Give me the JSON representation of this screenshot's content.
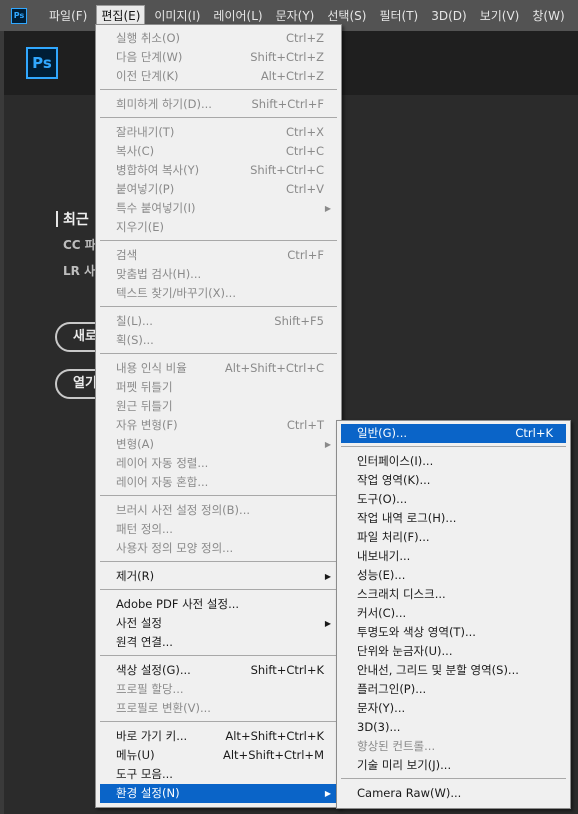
{
  "menubar": {
    "app_icon": "Ps",
    "items": [
      "파일(F)",
      "편집(E)",
      "이미지(I)",
      "레이어(L)",
      "문자(Y)",
      "선택(S)",
      "필터(T)",
      "3D(D)",
      "보기(V)",
      "창(W)"
    ],
    "active_index": 1
  },
  "home": {
    "logo": "Ps",
    "recent_title": "최근",
    "sub1": "CC 파",
    "sub2": "LR 사",
    "btn_new": "새로",
    "btn_open": "열기"
  },
  "edit_menu": {
    "undo": {
      "label": "실행 취소(O)",
      "shortcut": "Ctrl+Z"
    },
    "step_forward": {
      "label": "다음 단계(W)",
      "shortcut": "Shift+Ctrl+Z"
    },
    "step_backward": {
      "label": "이전 단계(K)",
      "shortcut": "Alt+Ctrl+Z"
    },
    "fade": {
      "label": "희미하게 하기(D)...",
      "shortcut": "Shift+Ctrl+F"
    },
    "cut": {
      "label": "잘라내기(T)",
      "shortcut": "Ctrl+X"
    },
    "copy": {
      "label": "복사(C)",
      "shortcut": "Ctrl+C"
    },
    "copy_merged": {
      "label": "병합하여 복사(Y)",
      "shortcut": "Shift+Ctrl+C"
    },
    "paste": {
      "label": "붙여넣기(P)",
      "shortcut": "Ctrl+V"
    },
    "paste_special": {
      "label": "특수 붙여넣기(I)"
    },
    "clear": {
      "label": "지우기(E)"
    },
    "search": {
      "label": "검색",
      "shortcut": "Ctrl+F"
    },
    "spelling": {
      "label": "맞춤법 검사(H)..."
    },
    "find_replace": {
      "label": "텍스트 찾기/바꾸기(X)..."
    },
    "fill": {
      "label": "칠(L)...",
      "shortcut": "Shift+F5"
    },
    "stroke": {
      "label": "획(S)..."
    },
    "content_aware_scale": {
      "label": "내용 인식 비율",
      "shortcut": "Alt+Shift+Ctrl+C"
    },
    "puppet_warp": {
      "label": "퍼펫 뒤틀기"
    },
    "perspective_warp": {
      "label": "원근 뒤틀기"
    },
    "free_transform": {
      "label": "자유 변형(F)",
      "shortcut": "Ctrl+T"
    },
    "transform": {
      "label": "변형(A)"
    },
    "auto_align": {
      "label": "레이어 자동 정렬..."
    },
    "auto_blend": {
      "label": "레이어 자동 혼합..."
    },
    "define_brush": {
      "label": "브러시 사전 설정 정의(B)..."
    },
    "define_pattern": {
      "label": "패턴 정의..."
    },
    "define_shape": {
      "label": "사용자 정의 모양 정의..."
    },
    "purge": {
      "label": "제거(R)"
    },
    "pdf_presets": {
      "label": "Adobe PDF 사전 설정..."
    },
    "presets": {
      "label": "사전 설정"
    },
    "remote_connections": {
      "label": "원격 연결..."
    },
    "color_settings": {
      "label": "색상 설정(G)...",
      "shortcut": "Shift+Ctrl+K"
    },
    "assign_profile": {
      "label": "프로필 할당..."
    },
    "convert_profile": {
      "label": "프로필로 변환(V)..."
    },
    "keyboard_shortcuts": {
      "label": "바로 가기 키...",
      "shortcut": "Alt+Shift+Ctrl+K"
    },
    "menus": {
      "label": "메뉴(U)",
      "shortcut": "Alt+Shift+Ctrl+M"
    },
    "toolbar": {
      "label": "도구 모음..."
    },
    "preferences": {
      "label": "환경 설정(N)"
    }
  },
  "pref_menu": {
    "general": {
      "label": "일반(G)...",
      "shortcut": "Ctrl+K"
    },
    "interface": "인터페이스(I)...",
    "workspace": "작업 영역(K)...",
    "tools": "도구(O)...",
    "history_log": "작업 내역 로그(H)...",
    "file_handling": "파일 처리(F)...",
    "export": "내보내기...",
    "performance": "성능(E)...",
    "scratch_disks": "스크래치 디스크...",
    "cursors": "커서(C)...",
    "transparency": "투명도와 색상 영역(T)...",
    "units_rulers": "단위와 눈금자(U)...",
    "guides_grid": "안내선, 그리드 및 분할 영역(S)...",
    "plugins": "플러그인(P)...",
    "type": "문자(Y)...",
    "threed": "3D(3)...",
    "enhanced_controls": "향상된 컨트롤...",
    "tech_previews": "기술 미리 보기(J)...",
    "camera_raw": "Camera Raw(W)..."
  },
  "colors": {
    "highlight": "#0a64c8",
    "menu_bg": "#f0f0f0",
    "menubar_bg": "#535353",
    "ps_blue": "#31a8ff"
  }
}
